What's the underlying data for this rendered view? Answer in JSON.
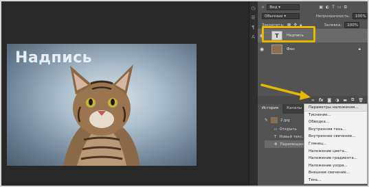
{
  "layers_panel": {
    "kind_label": "Вид",
    "blend_mode": "Обычные",
    "opacity_label": "Непрозрачность:",
    "opacity_value": "100%",
    "lock_label": "Закрепить:",
    "fill_label": "Заливка:",
    "fill_value": "100%",
    "layers": [
      {
        "name": "Надпись",
        "type": "text"
      },
      {
        "name": "Фон",
        "type": "image"
      }
    ]
  },
  "canvas": {
    "overlay_text": "Надпись"
  },
  "history_panel": {
    "tabs": [
      "История",
      "Каналы"
    ],
    "items": [
      "2.jpg",
      "Открыть",
      "Новый текс...",
      "Перемещен..."
    ]
  },
  "context_menu": {
    "items": [
      "Параметры наложения...",
      "Тиснение...",
      "Обводка...",
      "Внутренняя тень...",
      "Внутреннее свечение...",
      "Глянец...",
      "Наложение цвета...",
      "Наложение градиента...",
      "Наложение узора...",
      "Внешнее свечение...",
      "Тень..."
    ]
  },
  "colors": {
    "highlight": "#e6b800",
    "arrow": "#e6b800",
    "panel": "#535353",
    "workspace": "#282828"
  }
}
